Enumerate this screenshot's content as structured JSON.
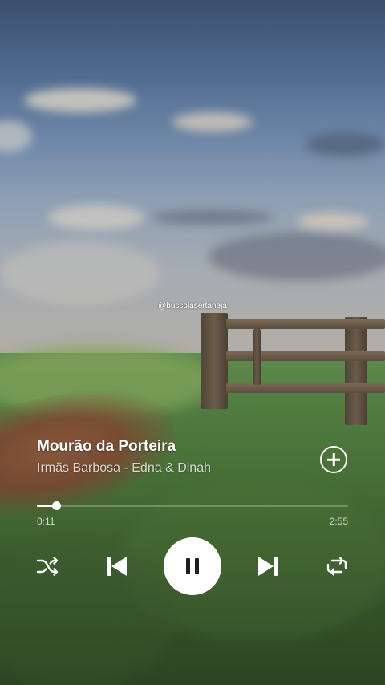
{
  "watermark": "@bussolasertaneja",
  "track": {
    "title": "Mourão da Porteira",
    "artist": "Irmãs Barbosa - Edna & Dinah"
  },
  "playback": {
    "elapsed": "0:11",
    "total": "2:55",
    "progress_fraction": 0.063,
    "state": "playing"
  },
  "controls": {
    "icons": [
      "shuffle-icon",
      "skip-previous-icon",
      "pause-icon",
      "skip-next-icon",
      "repeat-icon",
      "add-icon"
    ]
  },
  "colors": {
    "foreground": "#ffffff",
    "play_button_bg": "#ffffff",
    "play_button_icon": "#1f1f1f"
  }
}
